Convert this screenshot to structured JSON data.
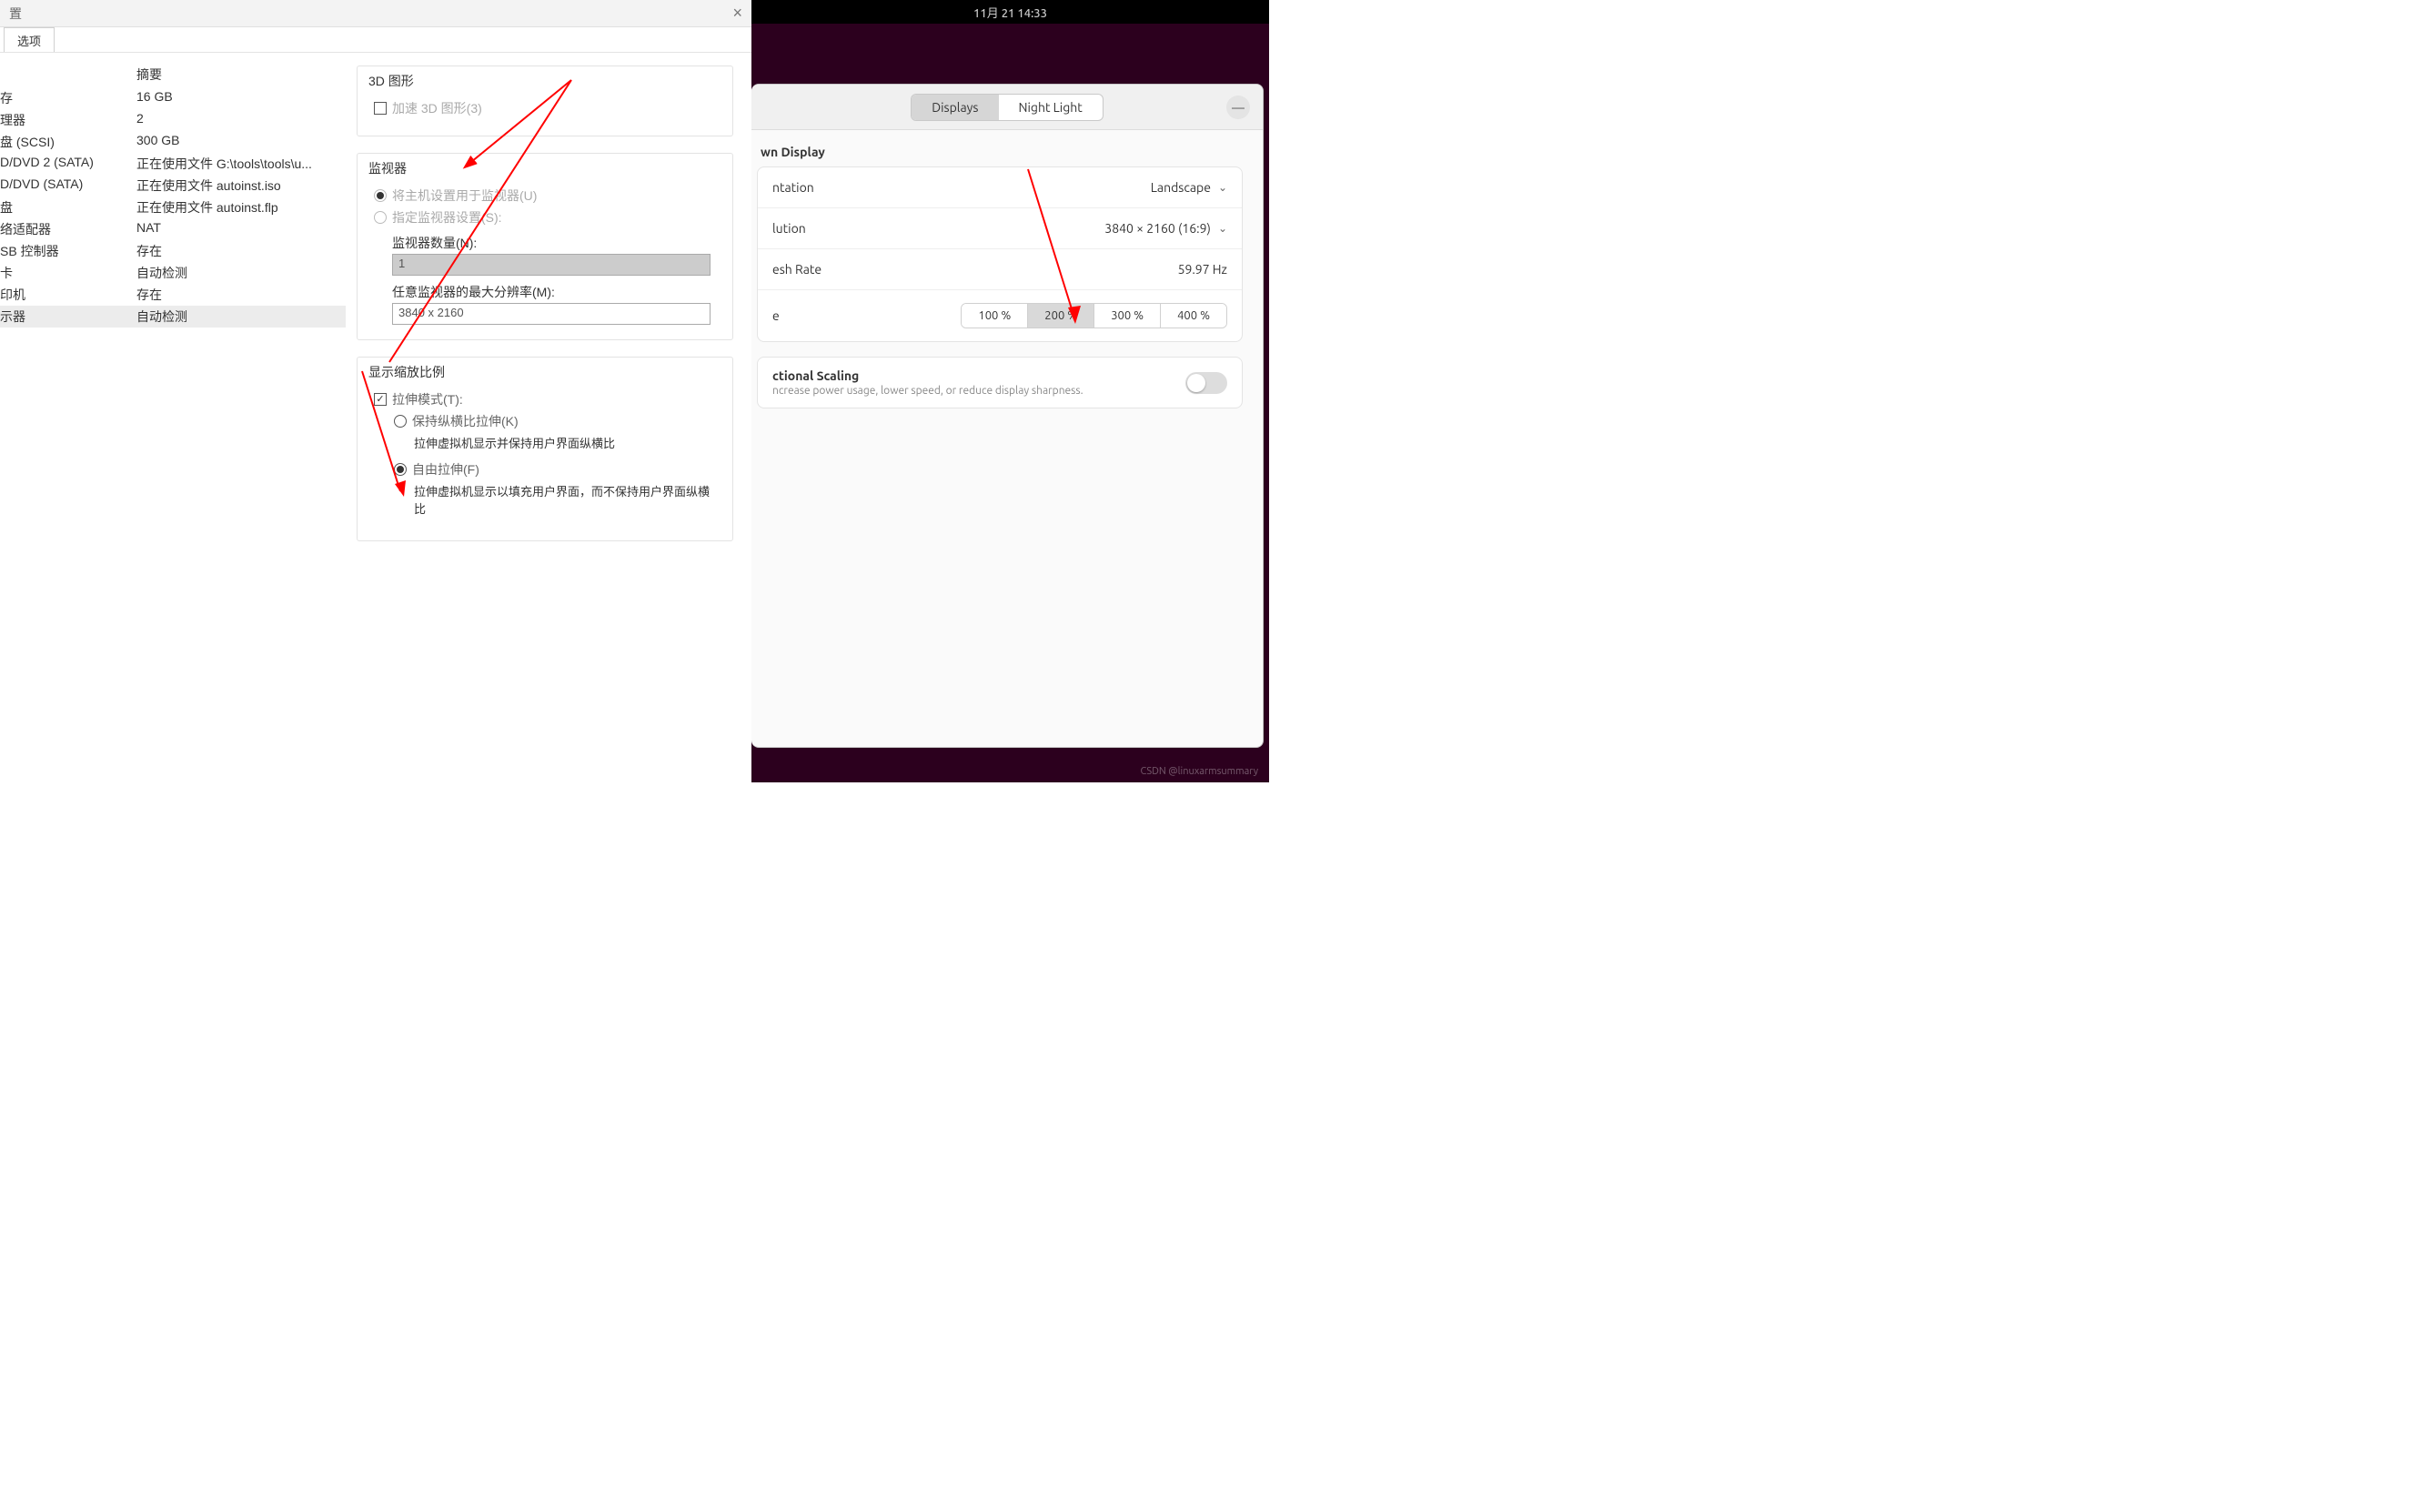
{
  "vm": {
    "title_fragment": "置",
    "tab_options": "选项",
    "list_header_summary": "摘要",
    "devices": [
      {
        "name": "存",
        "summary": "16 GB"
      },
      {
        "name": "理器",
        "summary": "2"
      },
      {
        "name": "盘 (SCSI)",
        "summary": "300 GB"
      },
      {
        "name": "D/DVD 2 (SATA)",
        "summary": "正在使用文件 G:\\tools\\tools\\u..."
      },
      {
        "name": "D/DVD (SATA)",
        "summary": "正在使用文件 autoinst.iso"
      },
      {
        "name": "盘",
        "summary": "正在使用文件 autoinst.flp"
      },
      {
        "name": "络适配器",
        "summary": "NAT"
      },
      {
        "name": "SB 控制器",
        "summary": "存在"
      },
      {
        "name": "卡",
        "summary": "自动检测"
      },
      {
        "name": "印机",
        "summary": "存在"
      },
      {
        "name": "示器",
        "summary": "自动检测"
      }
    ],
    "selected_index": 10,
    "section_3d": "3D 图形",
    "accel_3d": "加速 3D 图形(3)",
    "section_monitor": "监视器",
    "use_host": "将主机设置用于监视器(U)",
    "specify_monitor": "指定监视器设置(S):",
    "monitor_count_label": "监视器数量(N):",
    "monitor_count_value": "1",
    "max_res_label": "任意监视器的最大分辨率(M):",
    "max_res_value": "3840 x 2160",
    "section_scale": "显示缩放比例",
    "stretch_mode": "拉伸模式(T):",
    "keep_aspect": "保持纵横比拉伸(K)",
    "keep_aspect_desc": "拉伸虚拟机显示并保持用户界面纵横比",
    "free_stretch": "自由拉伸(F)",
    "free_stretch_desc": "拉伸虚拟机显示以填充用户界面，而不保持用户界面纵横比"
  },
  "ubuntu": {
    "clock": "11月 21  14:33",
    "tab_displays": "Displays",
    "tab_night": "Night Light",
    "section_title_frag": "wn Display",
    "rows": {
      "orientation_label_frag": "ntation",
      "orientation_value": "Landscape",
      "resolution_label_frag": "lution",
      "resolution_value": "3840 × 2160 (16:9)",
      "refresh_label_frag": "esh Rate",
      "refresh_value": "59.97 Hz",
      "scale_label_frag": "e"
    },
    "scale_options": [
      "100 %",
      "200 %",
      "300 %",
      "400 %"
    ],
    "scale_active_index": 1,
    "frac_title": "ctional Scaling",
    "frac_desc": "ncrease power usage, lower speed, or reduce display sharpness."
  },
  "watermark": "CSDN @linuxarmsummary"
}
